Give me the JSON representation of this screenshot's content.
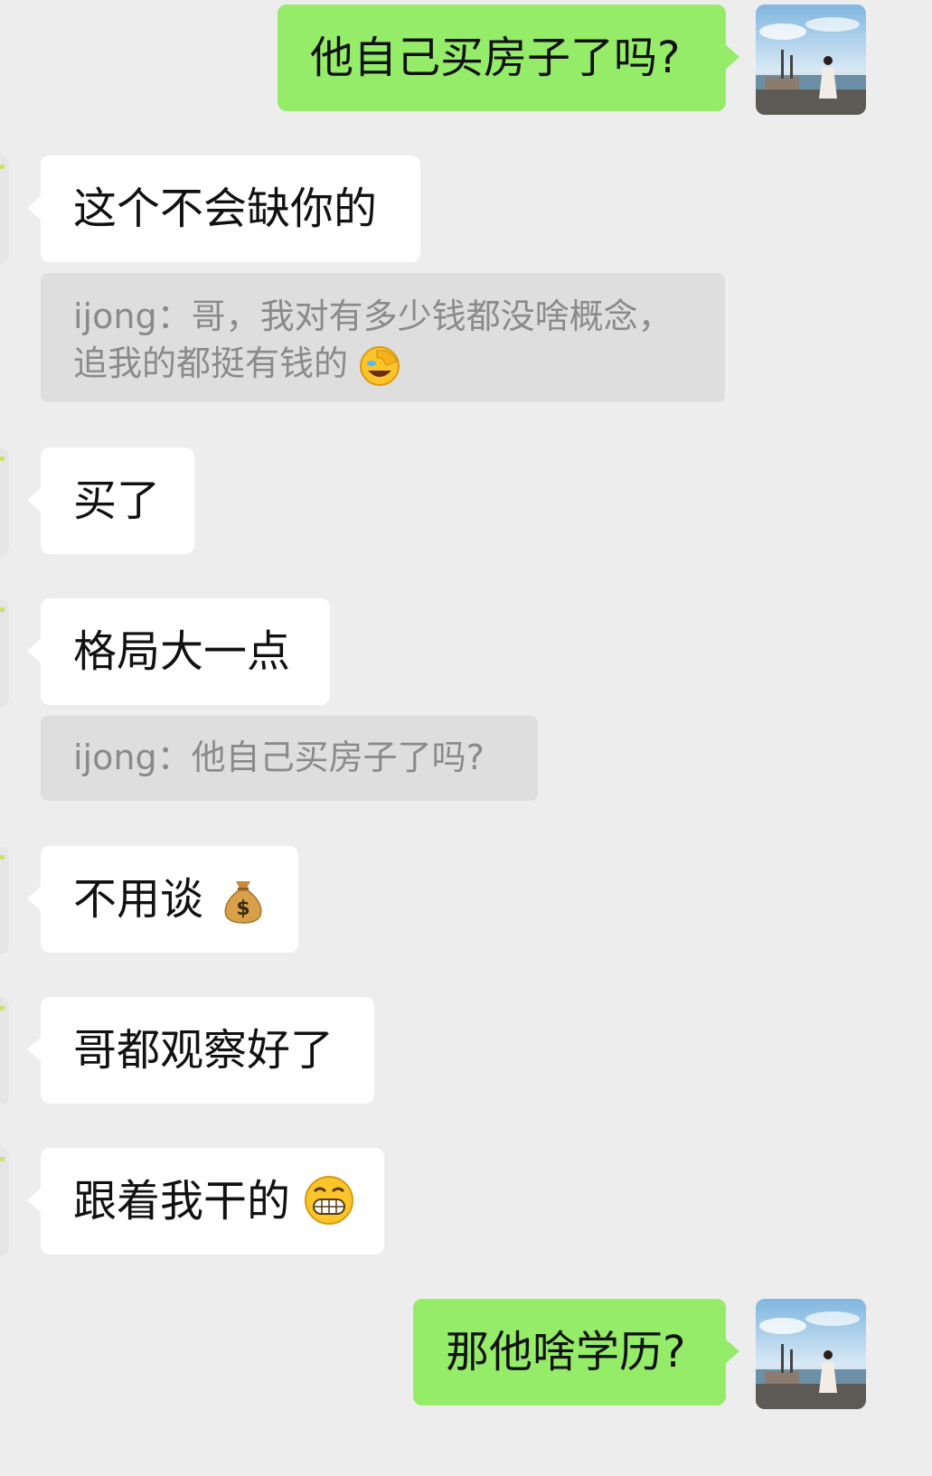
{
  "messages": {
    "m1": {
      "text": "他自己买房子了吗?"
    },
    "m2": {
      "text": "这个不会缺你的",
      "quote_line1": "ijong：哥，我对有多少钱都没啥概念，",
      "quote_line2": "追我的都挺有钱的"
    },
    "m3": {
      "text": "买了"
    },
    "m4": {
      "text": "格局大一点",
      "quote_line1": "ijong：他自己买房子了吗?"
    },
    "m5": {
      "text": "不用谈"
    },
    "m6": {
      "text": "哥都观察好了"
    },
    "m7": {
      "text": "跟着我干的"
    },
    "m8": {
      "text": "那他啥学历?"
    }
  },
  "colors": {
    "background": "#ededed",
    "outgoing_bubble": "#95ec69",
    "incoming_bubble": "#ffffff",
    "quote_background": "#dedede",
    "quote_text": "#8a8a8a"
  },
  "icons": [
    "sender-avatar-photo",
    "facepalm-laughing-emoji",
    "money-bag-emoji",
    "grinning-emoji"
  ]
}
